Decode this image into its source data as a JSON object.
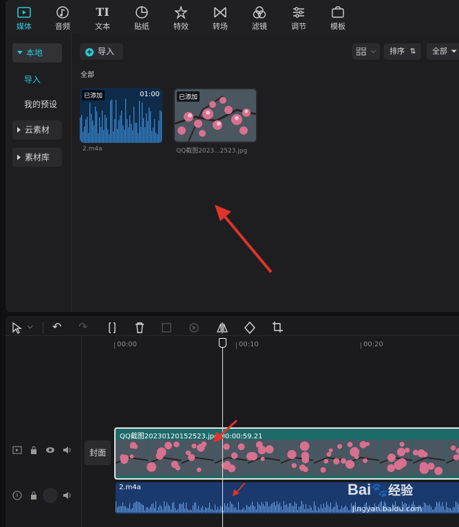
{
  "tabs": [
    {
      "label": "媒体",
      "icon": "media-icon"
    },
    {
      "label": "音频",
      "icon": "audio-icon"
    },
    {
      "label": "文本",
      "icon": "text-icon"
    },
    {
      "label": "贴纸",
      "icon": "sticker-icon"
    },
    {
      "label": "特效",
      "icon": "effects-icon"
    },
    {
      "label": "转场",
      "icon": "transition-icon"
    },
    {
      "label": "滤镜",
      "icon": "filter-icon"
    },
    {
      "label": "调节",
      "icon": "adjust-icon"
    },
    {
      "label": "模板",
      "icon": "template-icon"
    }
  ],
  "text_tab_glyph": "TI",
  "sidebar": {
    "local": "本地",
    "import": "导入",
    "my_presets": "我的预设",
    "cloud": "云素材",
    "library": "素材库"
  },
  "toolbar": {
    "import_label": "导入",
    "sort_label": "排序",
    "filter_label": "全部"
  },
  "section_label": "全部",
  "media": [
    {
      "tag": "已添加",
      "duration": "01:00",
      "name": "2.m4a"
    },
    {
      "tag": "已添加",
      "name": "QQ截图2023...2523.jpg"
    }
  ],
  "timeline": {
    "ruler": [
      "00:00",
      "00:10",
      "00:20"
    ],
    "cover_label": "封面",
    "video_clip_label": "QQ截图20230120152523.jpg  00:00:59.21",
    "audio_clip_label": "2.m4a"
  },
  "watermark": {
    "brand": "Bai",
    "brand2": "经验",
    "url": "jingyan.baidu.com"
  },
  "colors": {
    "accent": "#2fc8d6",
    "audio_clip": "#1a3a6e",
    "video_clip": "#1d6a6a"
  }
}
